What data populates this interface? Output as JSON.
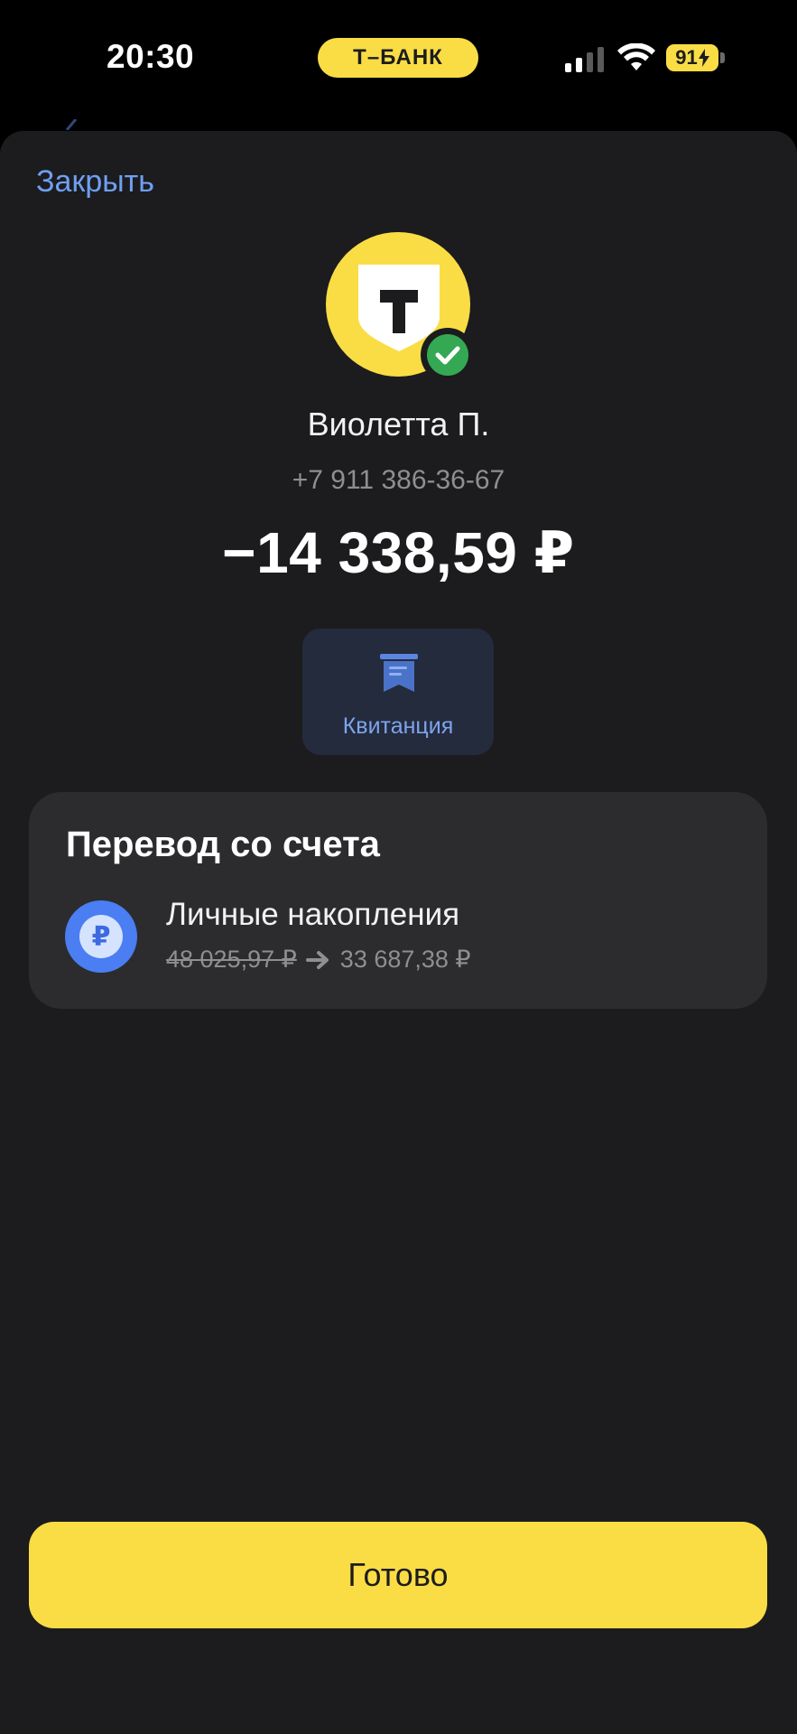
{
  "status_bar": {
    "time": "20:30",
    "bank_pill": "Т–БАНК",
    "battery": "91"
  },
  "sheet": {
    "close_label": "Закрыть",
    "recipient_name": "Виолетта П.",
    "recipient_phone": "+7 911 386-36-67",
    "amount": "−14 338,59 ₽",
    "receipt_label": "Квитанция"
  },
  "source_card": {
    "title": "Перевод со счета",
    "account_name": "Личные накопления",
    "balance_before": "48 025,97 ₽",
    "balance_after": "33 687,38 ₽",
    "currency_symbol": "₽"
  },
  "done_label": "Готово",
  "colors": {
    "accent_yellow": "#fadd45",
    "link_blue": "#6f9ff2",
    "sheet_bg": "#1c1c1e",
    "card_bg": "#2c2c2e",
    "success_green": "#34a853"
  }
}
